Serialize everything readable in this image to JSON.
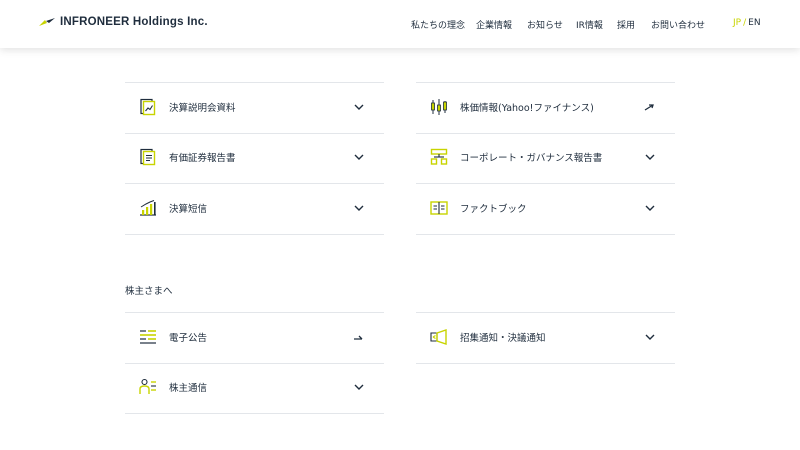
{
  "header": {
    "brand": "INFRONEER Holdings Inc.",
    "nav": [
      "私たちの理念",
      "企業情報",
      "お知らせ",
      "IR情報",
      "採用",
      "お問い合わせ"
    ],
    "lang": {
      "jp": "JP",
      "sep": "/",
      "en": "EN"
    }
  },
  "ir_library": {
    "left": [
      {
        "label": "決算説明会資料",
        "icon": "presentation-doc-icon",
        "action": "expand"
      },
      {
        "label": "有価証券報告書",
        "icon": "report-doc-icon",
        "action": "expand"
      },
      {
        "label": "決算短信",
        "icon": "bar-chart-icon",
        "action": "expand"
      }
    ],
    "right": [
      {
        "label": "株価情報(Yahoo!ファイナンス)",
        "icon": "candlestick-icon",
        "action": "external"
      },
      {
        "label": "コーポレート・ガバナンス報告書",
        "icon": "org-chart-icon",
        "action": "expand"
      },
      {
        "label": "ファクトブック",
        "icon": "open-book-icon",
        "action": "expand"
      }
    ]
  },
  "shareholders": {
    "title": "株主さまへ",
    "left": [
      {
        "label": "電子公告",
        "icon": "list-icon",
        "action": "external"
      },
      {
        "label": "株主通信",
        "icon": "people-icon",
        "action": "expand"
      }
    ],
    "right": [
      {
        "label": "招集通知・決議通知",
        "icon": "megaphone-icon",
        "action": "expand"
      }
    ]
  },
  "colors": {
    "accent": "#c8d400",
    "navy": "#1f2d3d",
    "divider": "#e3e6ea"
  }
}
